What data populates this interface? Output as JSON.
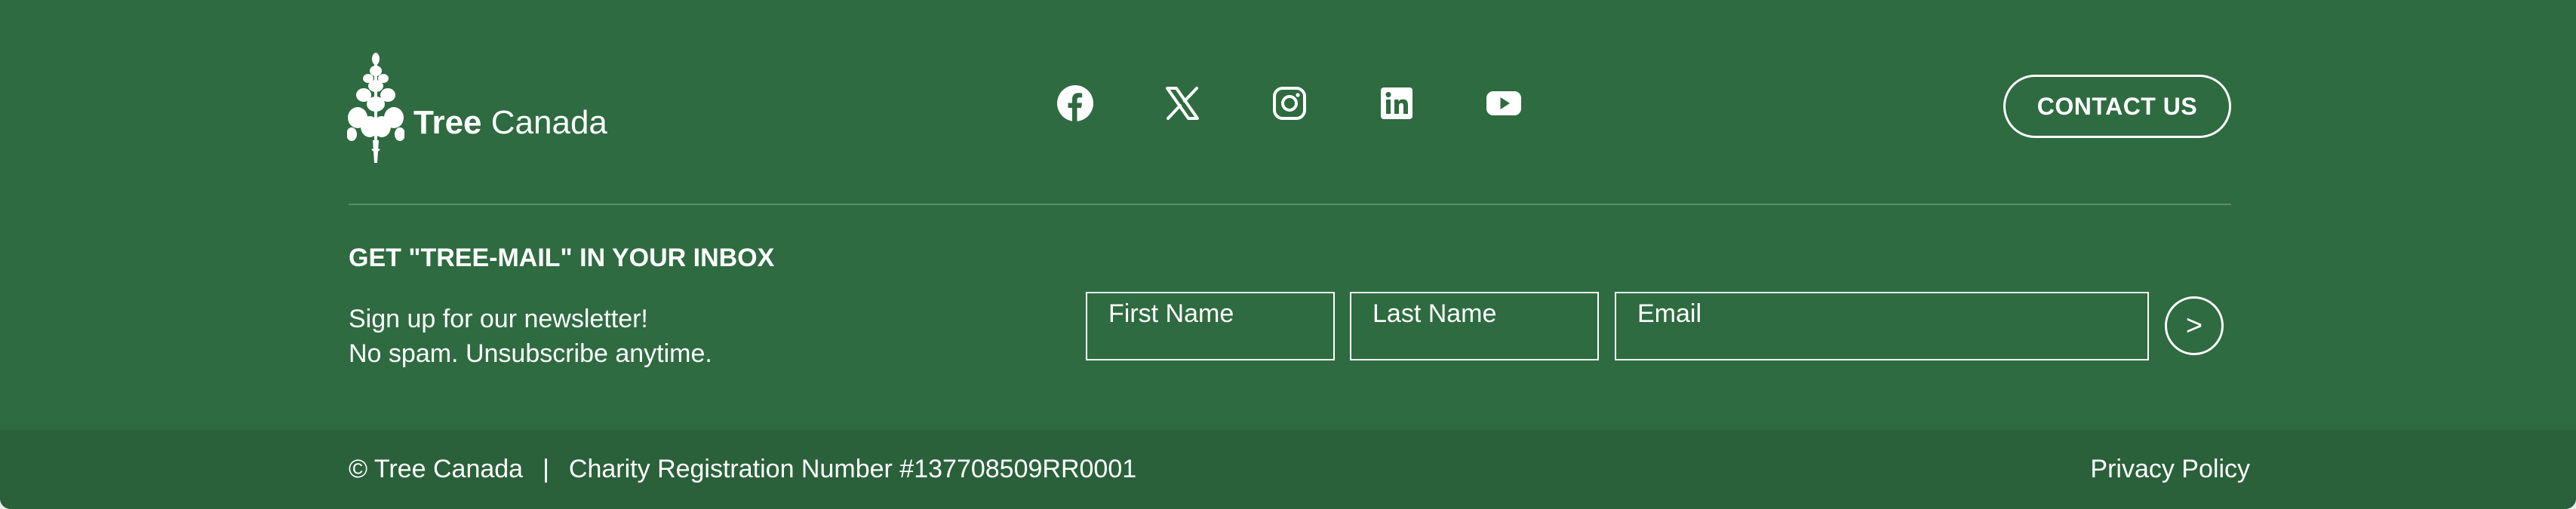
{
  "brand": {
    "name_bold": "Tree",
    "name_regular": "Canada"
  },
  "social": [
    {
      "name": "facebook",
      "icon": "facebook-icon"
    },
    {
      "name": "x",
      "icon": "x-icon"
    },
    {
      "name": "instagram",
      "icon": "instagram-icon"
    },
    {
      "name": "linkedin",
      "icon": "linkedin-icon"
    },
    {
      "name": "youtube",
      "icon": "youtube-icon"
    }
  ],
  "header": {
    "contact_label": "CONTACT US"
  },
  "newsletter": {
    "title": "GET \"TREE-MAIL\" IN YOUR INBOX",
    "line1": "Sign up for our newsletter!",
    "line2": "No spam. Unsubscribe anytime.",
    "first_name_placeholder": "First Name",
    "last_name_placeholder": "Last Name",
    "email_placeholder": "Email",
    "submit_label": ">"
  },
  "bottom": {
    "copyright": "© Tree Canada",
    "separator": "|",
    "charity": "Charity Registration Number #137708509RR0001",
    "privacy": "Privacy Policy"
  },
  "colors": {
    "background": "#2e6b40",
    "bottom_bar": "#2a613a",
    "foreground": "#ffffff",
    "divider": "#5c8c69"
  }
}
